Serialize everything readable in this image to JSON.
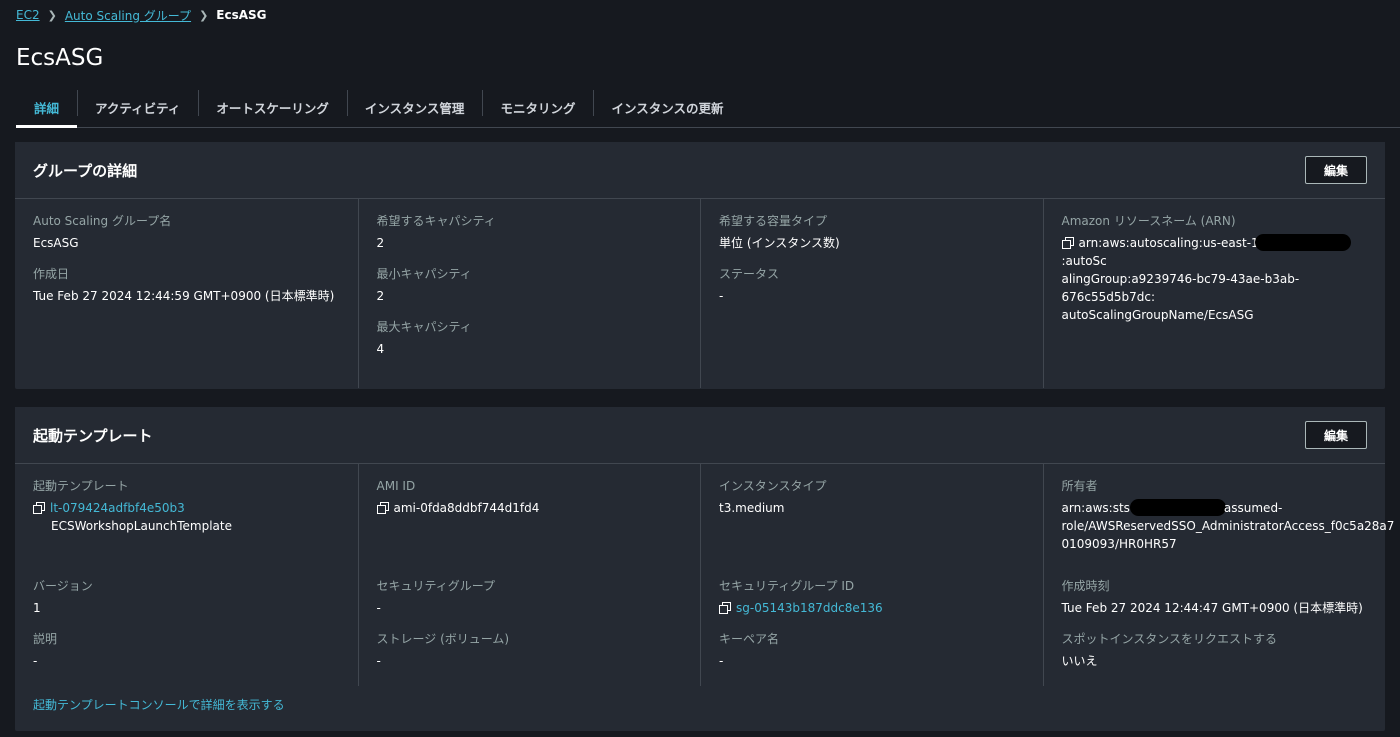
{
  "breadcrumb": {
    "ec2": "EC2",
    "asg": "Auto Scaling グループ",
    "current": "EcsASG"
  },
  "page_title": "EcsASG",
  "tabs": [
    {
      "label": "詳細"
    },
    {
      "label": "アクティビティ"
    },
    {
      "label": "オートスケーリング"
    },
    {
      "label": "インスタンス管理"
    },
    {
      "label": "モニタリング"
    },
    {
      "label": "インスタンスの更新"
    }
  ],
  "group_details": {
    "title": "グループの詳細",
    "edit_label": "編集",
    "asg_name_label": "Auto Scaling グループ名",
    "asg_name_value": "EcsASG",
    "created_label": "作成日",
    "created_value": "Tue Feb 27 2024 12:44:59 GMT+0900 (日本標準時)",
    "desired_label": "希望するキャパシティ",
    "desired_value": "2",
    "min_label": "最小キャパシティ",
    "min_value": "2",
    "max_label": "最大キャパシティ",
    "max_value": "4",
    "capacity_type_label": "希望する容量タイプ",
    "capacity_type_value": "単位 (インスタンス数)",
    "status_label": "ステータス",
    "status_value": "-",
    "arn_label": "Amazon リソースネーム (ARN)",
    "arn_line1_a": "arn:aws:autoscaling:us-east-1",
    "arn_line1_b": ":autoSc",
    "arn_line2": "alingGroup:a9239746-bc79-43ae-b3ab-676c55d5b7dc:",
    "arn_line3": "autoScalingGroupName/EcsASG"
  },
  "launch_template": {
    "title": "起動テンプレート",
    "edit_label": "編集",
    "lt_label": "起動テンプレート",
    "lt_id": "lt-079424adfbf4e50b3",
    "lt_name": "ECSWorkshopLaunchTemplate",
    "ami_label": "AMI ID",
    "ami_value": "ami-0fda8ddbf744d1fd4",
    "instance_type_label": "インスタンスタイプ",
    "instance_type_value": "t3.medium",
    "owner_label": "所有者",
    "owner_line1_a": "arn:aws:sts",
    "owner_line1_b": "assumed-",
    "owner_line2": "role/AWSReservedSSO_AdministratorAccess_f0c5a28a7",
    "owner_line3": "0109093/HR0HR57",
    "version_label": "バージョン",
    "version_value": "1",
    "sg_label": "セキュリティグループ",
    "sg_value": "-",
    "sg_id_label": "セキュリティグループ ID",
    "sg_id_value": "sg-05143b187ddc8e136",
    "created_time_label": "作成時刻",
    "created_time_value": "Tue Feb 27 2024 12:44:47 GMT+0900 (日本標準時)",
    "desc_label": "説明",
    "desc_value": "-",
    "storage_label": "ストレージ (ボリューム)",
    "storage_value": "-",
    "keypair_label": "キーペア名",
    "keypair_value": "-",
    "spot_label": "スポットインスタンスをリクエストする",
    "spot_value": "いいえ",
    "console_link": "起動テンプレートコンソールで詳細を表示する"
  }
}
